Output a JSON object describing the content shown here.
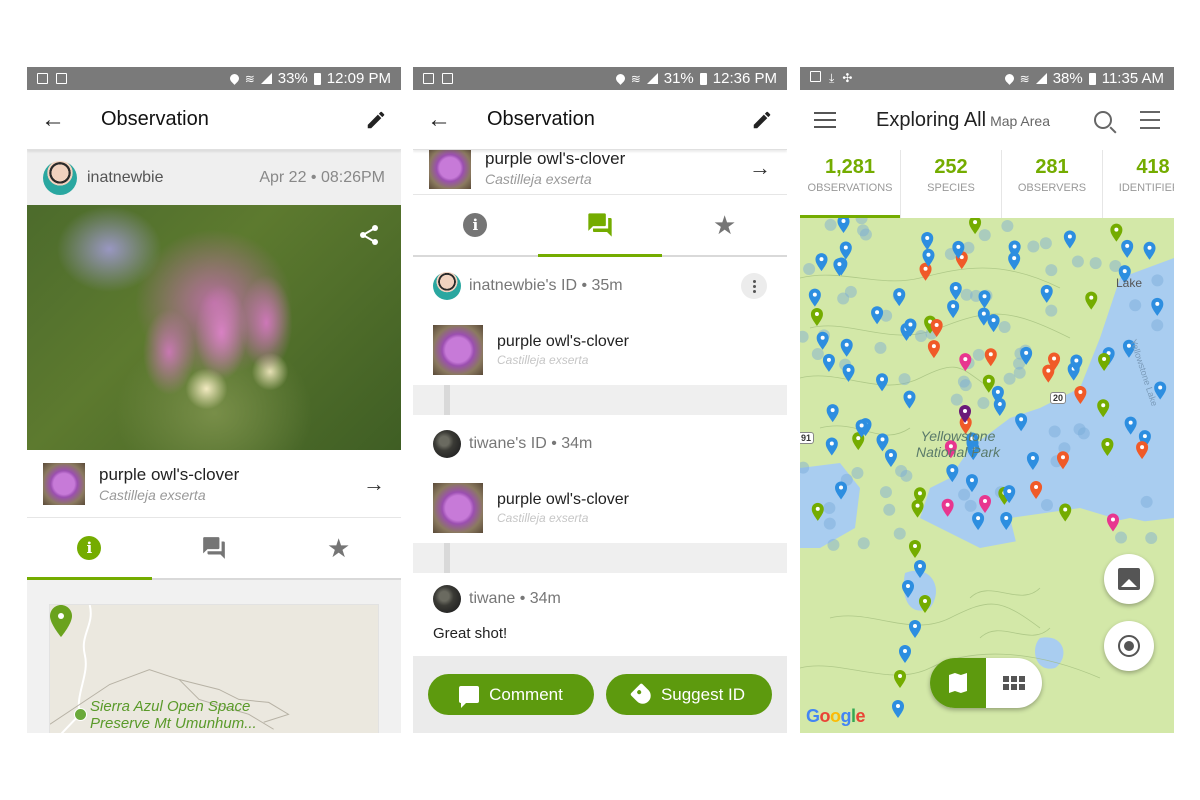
{
  "screens": [
    {
      "status": {
        "battery": "33%",
        "time": "12:09 PM"
      },
      "appbar": {
        "title": "Observation"
      },
      "observer": {
        "username": "inatnewbie",
        "date": "Apr 22 • 08:26PM"
      },
      "taxon": {
        "common_name": "purple owl's-clover",
        "scientific_name": "Castilleja exserta"
      },
      "tabs": [
        {
          "icon": "info-icon",
          "active": true
        },
        {
          "icon": "chat-icon",
          "active": false
        },
        {
          "icon": "star-icon",
          "active": false
        }
      ],
      "map": {
        "place_label_line1": "Sierra Azul Open Space",
        "place_label_line2": "Preserve Mt Umunhum..."
      }
    },
    {
      "status": {
        "battery": "31%",
        "time": "12:36 PM"
      },
      "appbar": {
        "title": "Observation"
      },
      "taxon": {
        "common_name": "purple owl's-clover",
        "scientific_name": "Castilleja exserta"
      },
      "tabs": [
        {
          "icon": "info-icon",
          "active": false
        },
        {
          "icon": "chat-icon",
          "active": true
        },
        {
          "icon": "star-icon",
          "active": false
        }
      ],
      "activity": [
        {
          "type": "identification",
          "header": "inatnewbie's ID • 35m",
          "common_name": "purple owl's-clover",
          "scientific_name": "Castilleja exserta"
        },
        {
          "type": "identification",
          "header": "tiwane's ID • 34m",
          "common_name": "purple owl's-clover",
          "scientific_name": "Castilleja exserta"
        },
        {
          "type": "comment",
          "header": "tiwane • 34m",
          "body": "Great shot!"
        }
      ],
      "actions": {
        "comment_label": "Comment",
        "suggest_label": "Suggest ID"
      }
    },
    {
      "status": {
        "battery": "38%",
        "time": "11:35 AM"
      },
      "explore": {
        "title": "Exploring All",
        "subtitle": "Map Area"
      },
      "stats": [
        {
          "value": "1,281",
          "label": "OBSERVATIONS",
          "active": true
        },
        {
          "value": "252",
          "label": "SPECIES",
          "active": false
        },
        {
          "value": "281",
          "label": "OBSERVERS",
          "active": false
        },
        {
          "value": "418",
          "label": "IDENTIFIERS",
          "active": false
        }
      ],
      "map": {
        "park_label_line1": "Yellowstone",
        "park_label_line2": "National Park",
        "lake_label": "Lake",
        "lake_name": "Yellowstone Lake",
        "route_20": "20",
        "route_191": "91",
        "attribution": [
          "G",
          "o",
          "o",
          "g",
          "l",
          "e"
        ]
      }
    }
  ],
  "colors": {
    "accent": "#74ac00",
    "button_green": "#5d9a0e",
    "statusbar": "#7a7a7a",
    "pin_blue": "#2d8ee0",
    "pin_green": "#74ac00",
    "pin_pink": "#e8368f",
    "pin_orange": "#f05a28",
    "pin_purple": "#6b1a7a"
  }
}
